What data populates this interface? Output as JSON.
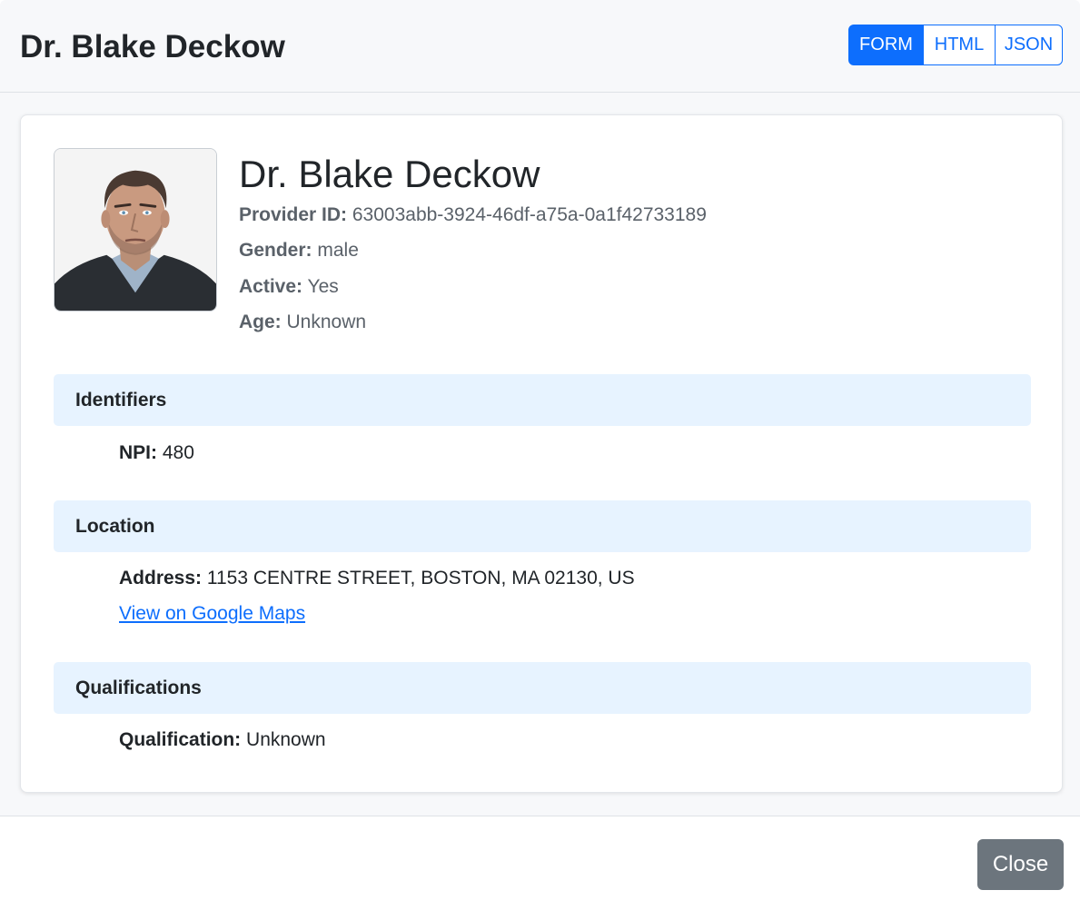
{
  "header": {
    "title": "Dr. Blake Deckow",
    "view_buttons": [
      {
        "label": "FORM",
        "active": true
      },
      {
        "label": "HTML",
        "active": false
      },
      {
        "label": "JSON",
        "active": false
      }
    ]
  },
  "provider": {
    "name": "Dr. Blake Deckow",
    "avatar_icon": "provider-photo",
    "fields": {
      "provider_id": {
        "label": "Provider ID:",
        "value": "63003abb-3924-46df-a75a-0a1f42733189"
      },
      "gender": {
        "label": "Gender:",
        "value": "male"
      },
      "active": {
        "label": "Active:",
        "value": "Yes"
      },
      "age": {
        "label": "Age:",
        "value": "Unknown"
      }
    }
  },
  "sections": {
    "identifiers": {
      "title": "Identifiers",
      "npi": {
        "label": "NPI:",
        "value": "480"
      }
    },
    "location": {
      "title": "Location",
      "address": {
        "label": "Address:",
        "value": "1153 CENTRE STREET, BOSTON, MA 02130, US"
      },
      "maps_link": "View on Google Maps"
    },
    "qualifications": {
      "title": "Qualifications",
      "qualification": {
        "label": "Qualification:",
        "value": "Unknown"
      }
    }
  },
  "footer": {
    "close_label": "Close"
  },
  "colors": {
    "primary": "#0d6efd",
    "section_bg": "#e7f3ff",
    "secondary_button": "#6c757d"
  }
}
